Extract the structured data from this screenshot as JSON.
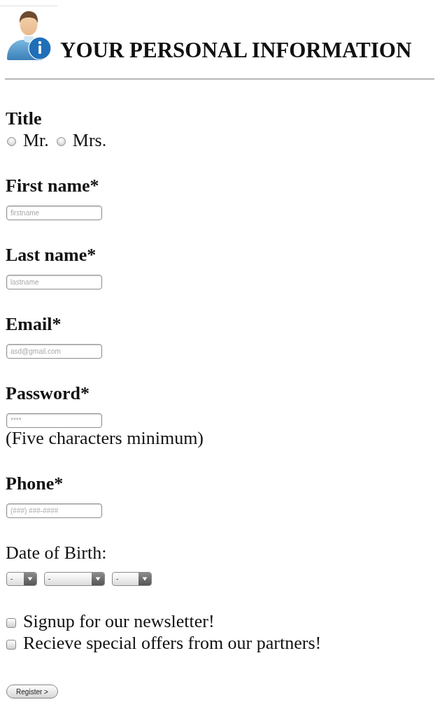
{
  "header": {
    "title": "YOUR PERSONAL INFORMATION"
  },
  "title_group": {
    "label": "Title",
    "options": [
      {
        "label": "Mr.",
        "selected": false
      },
      {
        "label": "Mrs.",
        "selected": false
      }
    ]
  },
  "fields": [
    {
      "label": "First name*",
      "placeholder": "firstname"
    },
    {
      "label": "Last name*",
      "placeholder": "lastname"
    },
    {
      "label": "Email*",
      "placeholder": "asd@gmail.com"
    },
    {
      "label": "Password*",
      "placeholder": "****",
      "hint": "(Five characters minimum)"
    },
    {
      "label": "Phone*",
      "placeholder": "(###) ###-####"
    }
  ],
  "date_of_birth": {
    "label": "Date of Birth:",
    "selects": [
      {
        "value": "-"
      },
      {
        "value": "-"
      },
      {
        "value": "-"
      }
    ]
  },
  "checkboxes": [
    {
      "label": "Signup for our newsletter!",
      "checked": false
    },
    {
      "label": "Recieve special offers from our partners!",
      "checked": false
    }
  ],
  "register_button": {
    "label": "Register >"
  }
}
